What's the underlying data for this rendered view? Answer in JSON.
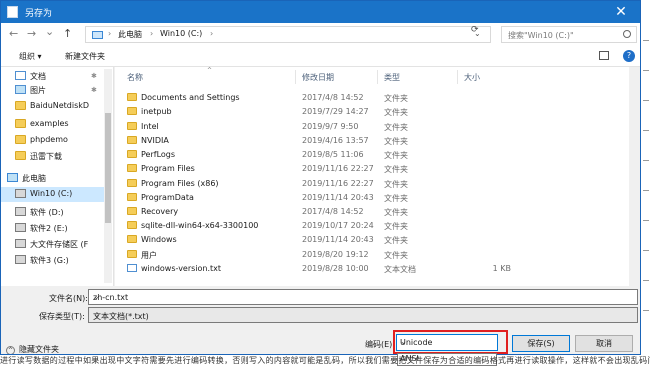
{
  "window": {
    "title": "另存为",
    "close_glyph": "✕"
  },
  "addressbar": {
    "back_glyph": "←",
    "forward_glyph": "→",
    "history_glyph": "⌄",
    "up_glyph": "↑",
    "crumbs": [
      "此电脑",
      "Win10 (C:)"
    ],
    "sep_glyph": "›",
    "search_placeholder": "搜索\"Win10 (C:)\""
  },
  "toolbar": {
    "organize_label": "组织 ▾",
    "new_folder_label": "新建文件夹",
    "help_glyph": "?"
  },
  "sidebar": {
    "items": [
      {
        "label": "文档",
        "icon": "document-icon",
        "pinned": true
      },
      {
        "label": "图片",
        "icon": "picture-icon",
        "pinned": true
      },
      {
        "label": "BaiduNetdiskD",
        "icon": "folder-icon",
        "pinned": false
      },
      {
        "label": "examples",
        "icon": "folder-icon",
        "pinned": false
      },
      {
        "label": "phpdemo",
        "icon": "folder-icon",
        "pinned": false
      },
      {
        "label": "迅雷下载",
        "icon": "folder-icon",
        "pinned": false
      },
      {
        "label": "此电脑",
        "icon": "computer-icon",
        "pinned": false
      },
      {
        "label": "Win10 (C:)",
        "icon": "drive-icon",
        "pinned": false,
        "selected": true
      },
      {
        "label": "软件 (D:)",
        "icon": "drive-icon",
        "pinned": false
      },
      {
        "label": "软件2 (E:)",
        "icon": "drive-icon",
        "pinned": false
      },
      {
        "label": "大文件存储区 (F",
        "icon": "drive-icon",
        "pinned": false
      },
      {
        "label": "软件3 (G:)",
        "icon": "drive-icon",
        "pinned": false
      }
    ],
    "pin_glyph": "✱"
  },
  "filelist": {
    "columns": {
      "name": "名称",
      "date": "修改日期",
      "type": "类型",
      "size": "大小"
    },
    "sort_glyph": "^",
    "rows": [
      {
        "name": "Documents and Settings",
        "date": "2017/4/8 14:52",
        "type": "文件夹",
        "size": "",
        "icon": "folder-icon"
      },
      {
        "name": "inetpub",
        "date": "2019/7/29 14:27",
        "type": "文件夹",
        "size": "",
        "icon": "folder-icon"
      },
      {
        "name": "Intel",
        "date": "2019/9/7 9:50",
        "type": "文件夹",
        "size": "",
        "icon": "folder-icon"
      },
      {
        "name": "NVIDIA",
        "date": "2019/4/16 13:57",
        "type": "文件夹",
        "size": "",
        "icon": "folder-icon"
      },
      {
        "name": "PerfLogs",
        "date": "2019/8/5 11:06",
        "type": "文件夹",
        "size": "",
        "icon": "folder-icon"
      },
      {
        "name": "Program Files",
        "date": "2019/11/16 22:27",
        "type": "文件夹",
        "size": "",
        "icon": "folder-icon"
      },
      {
        "name": "Program Files (x86)",
        "date": "2019/11/16 22:27",
        "type": "文件夹",
        "size": "",
        "icon": "folder-icon"
      },
      {
        "name": "ProgramData",
        "date": "2019/11/14 20:43",
        "type": "文件夹",
        "size": "",
        "icon": "folder-icon"
      },
      {
        "name": "Recovery",
        "date": "2017/4/8 14:52",
        "type": "文件夹",
        "size": "",
        "icon": "folder-icon"
      },
      {
        "name": "sqlite-dll-win64-x64-3300100",
        "date": "2019/10/17 20:24",
        "type": "文件夹",
        "size": "",
        "icon": "folder-icon"
      },
      {
        "name": "Windows",
        "date": "2019/11/14 20:43",
        "type": "文件夹",
        "size": "",
        "icon": "folder-icon"
      },
      {
        "name": "用户",
        "date": "2019/8/20 19:12",
        "type": "文件夹",
        "size": "",
        "icon": "folder-icon"
      },
      {
        "name": "windows-version.txt",
        "date": "2019/8/28 10:00",
        "type": "文本文档",
        "size": "1 KB",
        "icon": "text-file-icon"
      }
    ]
  },
  "form": {
    "filename_label": "文件名(N):",
    "filename_value": "zh-cn.txt",
    "filetype_label": "保存类型(T):",
    "filetype_value": "文本文档(*.txt)",
    "hide_folders_label": "隐藏文件夹",
    "encoding_label": "编码(E):",
    "encoding_value": "Unicode",
    "encoding_option_visible": "ANSI",
    "save_label": "保存(S)",
    "cancel_label": "取消",
    "caret_glyph": "⌄"
  },
  "background": {
    "text": "进行读写数据的过程中如果出现中文字符需要先进行编码转换，否则写入的内容就可能是乱码，所以我们需要把文件保存为合适的编码格式再进行读取操作，这样就不会出现乱码问题了"
  },
  "colors": {
    "titlebar": "#1a73c8",
    "selection": "#cce8ff",
    "highlight_box": "#e01f1f",
    "folder": "#f5cd59"
  }
}
